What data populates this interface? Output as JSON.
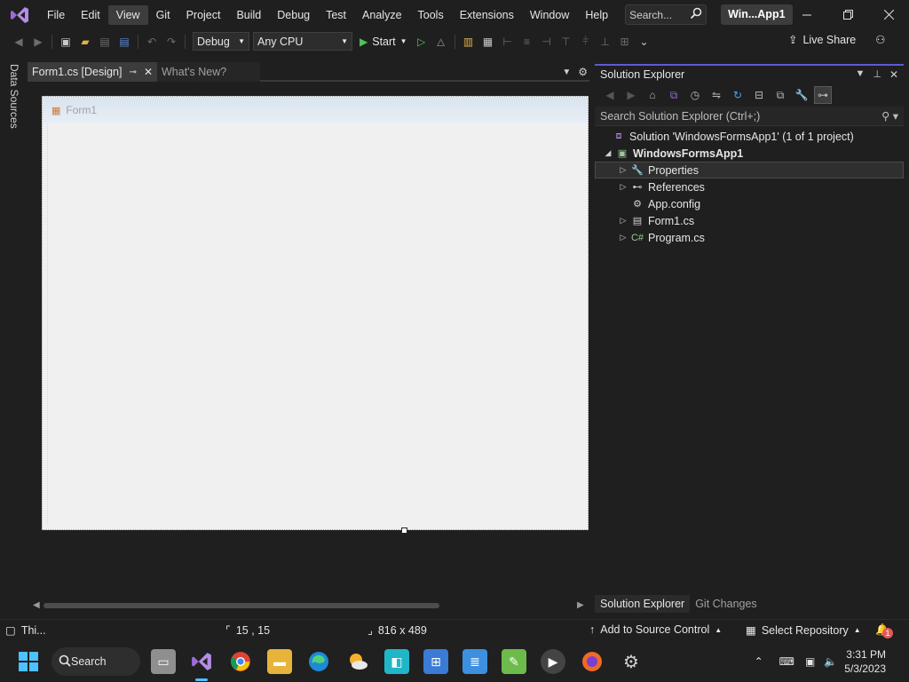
{
  "titlebar": {
    "menu": [
      "File",
      "Edit",
      "View",
      "Git",
      "Project",
      "Build",
      "Debug",
      "Test",
      "Analyze",
      "Tools",
      "Extensions",
      "Window",
      "Help"
    ],
    "search_label": "Search...",
    "solution_name": "Win...App1"
  },
  "toolbar": {
    "config": "Debug",
    "platform": "Any CPU",
    "start_label": "Start",
    "live_share": "Live Share"
  },
  "left_strip": {
    "data_sources": "Data Sources"
  },
  "document": {
    "tabs": [
      {
        "label": "Form1.cs [Design]",
        "active": true
      },
      {
        "label": "What's New?",
        "active": false
      }
    ],
    "form_title": "Form1"
  },
  "solution_explorer": {
    "title": "Solution Explorer",
    "search_placeholder": "Search Solution Explorer (Ctrl+;)",
    "tree": [
      {
        "label": "Solution 'WindowsFormsApp1' (1 of 1 project)",
        "icon": "solution-icon"
      },
      {
        "label": "WindowsFormsApp1",
        "icon": "csharp-project-icon"
      },
      {
        "label": "Properties",
        "icon": "wrench-icon"
      },
      {
        "label": "References",
        "icon": "references-icon"
      },
      {
        "label": "App.config",
        "icon": "config-icon"
      },
      {
        "label": "Form1.cs",
        "icon": "form-icon"
      },
      {
        "label": "Program.cs",
        "icon": "csharp-file-icon"
      }
    ],
    "bottom_tabs": [
      "Solution Explorer",
      "Git Changes"
    ]
  },
  "statusbar": {
    "message": "Thi...",
    "position": "15 , 15",
    "size": "816 x 489",
    "source_control": "Add to Source Control",
    "repository": "Select Repository",
    "notifications": "1"
  },
  "taskbar": {
    "search_label": "Search",
    "time": "3:31 PM",
    "date": "5/3/2023"
  },
  "colors": {
    "accent": "#5b5bd6",
    "vs_purple": "#9b6cd6",
    "play_green": "#4ec35a",
    "taskbar_underline": "#4cc2ff"
  }
}
